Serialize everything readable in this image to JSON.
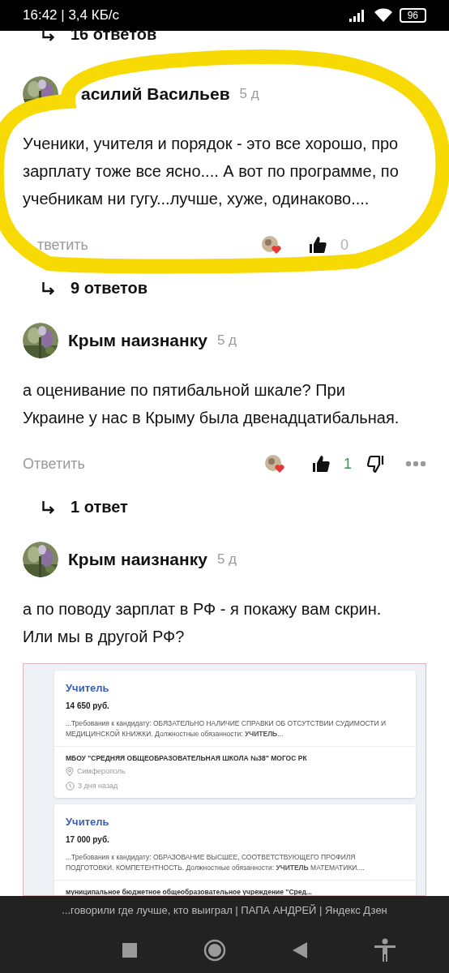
{
  "status_bar": {
    "time": "16:42 | 3,4 КБ/с",
    "battery": "96"
  },
  "top_replies": "16 ответов",
  "comments": [
    {
      "author": "асилий Васильев",
      "age": "5 д",
      "text": "Ученики, учителя и порядок - это все хорошо, про зарплату тоже все ясно.... А вот по программе, по учебникам ни гугу...лучше, хуже, одинаково....",
      "reply": "тветить",
      "likes": "0",
      "color": "#b0b0b0",
      "show_dislike": false,
      "replies": "9 ответов"
    },
    {
      "author": "Крым наизнанку",
      "age": "5 д",
      "text": "а оценивание по пятибальной шкале? При Украине у нас в Крыму была двенадцатибальная.",
      "reply": "Ответить",
      "likes": "1",
      "color": "#2ea043",
      "show_dislike": true,
      "replies": "1 ответ"
    },
    {
      "author": "Крым наизнанку",
      "age": "5 д",
      "text": "а по поводу зарплат в РФ - я покажу вам скрин. Или мы в другой РФ?"
    }
  ],
  "screenshot": {
    "vacancies": [
      {
        "title": "Учитель",
        "salary": "14 650 руб.",
        "snippet": "...Требования к кандидату: ОБЯЗАТЕЛЬНО НАЛИЧИЕ СПРАВКИ ОБ ОТСУТСТВИИ СУДИМОСТИ И МЕДИЦИНСКОЙ КНИЖКИ. Должностные обязанности: **УЧИТЕЛЬ**...",
        "org": "МБОУ \"СРЕДНЯЯ ОБЩЕОБРАЗОВАТЕЛЬНАЯ ШКОЛА №38\" МОГОС РК",
        "city": "Симферополь",
        "posted": "3 дня назад"
      },
      {
        "title": "Учитель",
        "salary": "17 000 руб.",
        "snippet": "...Требования к кандидату: ОБРАЗОВАНИЕ ВЫСШЕЕ, СООТВЕТСТВУЮЩЕГО ПРОФИЛЯ ПОДГОТОВКИ. КОМПЕТЕНТНОСТЬ. Должностные обязанности: **УЧИТЕЛЬ** МАТЕМАТИКИ....",
        "org": "муниципальное бюджетное общеобразовательное учреждение \"Сред..."
      }
    ]
  },
  "page_title": "...говорили где лучше, кто выиграл | ПАПА АНДРЕЙ | Яндекс Дзен"
}
